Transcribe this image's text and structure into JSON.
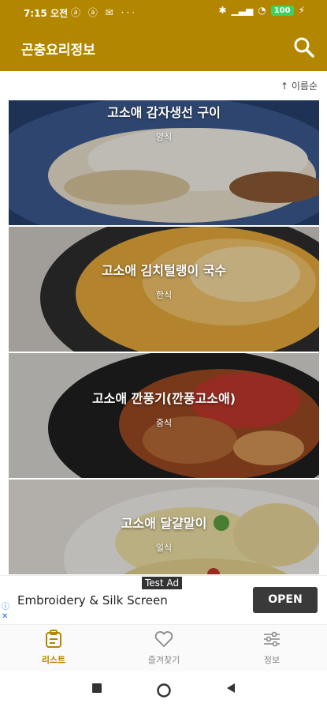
{
  "status_bar": {
    "time": "7:15 오전",
    "left_icons": "ⓐ ⓐ ✉ ···",
    "battery": "100"
  },
  "app_bar": {
    "title": "곤충요리정보"
  },
  "sort": {
    "label": "↑ 이름순"
  },
  "recipes": [
    {
      "name": "고소애 감자생선 구이",
      "category": "양식"
    },
    {
      "name": "고소애 김치털랭이 국수",
      "category": "한식"
    },
    {
      "name": "고소애 깐풍기(깐풍고소애)",
      "category": "중식"
    },
    {
      "name": "고소애 달걀말이",
      "category": "일식"
    }
  ],
  "ad": {
    "tag": "Test Ad",
    "text": "Embroidery & Silk Screen",
    "button": "OPEN"
  },
  "tabs": [
    {
      "label": "리스트",
      "icon": "clipboard-icon"
    },
    {
      "label": "즐겨찾기",
      "icon": "heart-icon"
    },
    {
      "label": "정보",
      "icon": "sliders-icon"
    }
  ],
  "colors": {
    "brand": "#b38600",
    "ad_button": "#3a3a3a"
  }
}
